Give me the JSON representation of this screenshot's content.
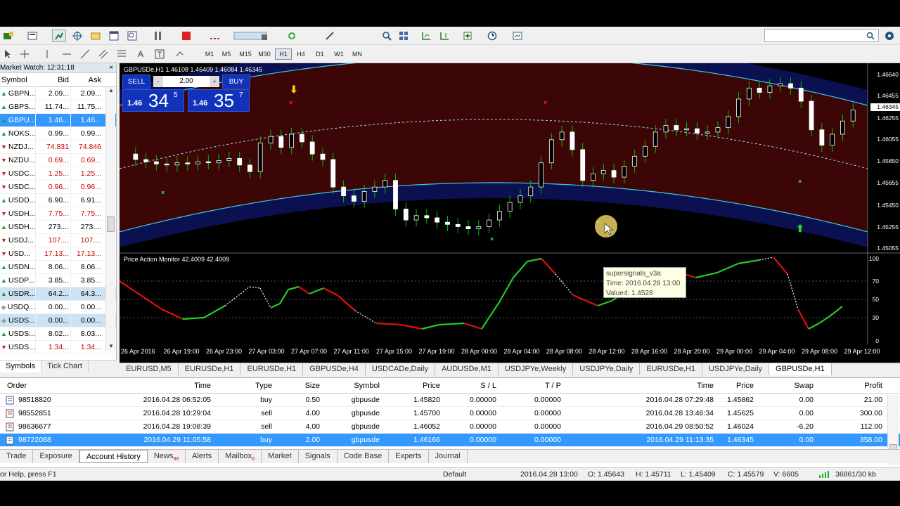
{
  "toolbar": {
    "timeframes": [
      "M1",
      "M5",
      "M15",
      "M30",
      "H1",
      "H4",
      "D1",
      "W1",
      "MN"
    ],
    "active_timeframe": "H1"
  },
  "market_watch": {
    "title": "Market Watch: 12:31:18",
    "close": "×",
    "columns": {
      "symbol": "Symbol",
      "bid": "Bid",
      "ask": "Ask"
    },
    "rows": [
      {
        "symbol": "GBPN...",
        "bid": "2.09...",
        "ask": "2.09...",
        "dir": "up",
        "state": ""
      },
      {
        "symbol": "GBPS...",
        "bid": "11.74...",
        "ask": "11.75...",
        "dir": "up",
        "state": ""
      },
      {
        "symbol": "GBPU...",
        "bid": "1.46...",
        "ask": "1.46...",
        "dir": "up",
        "state": "sel"
      },
      {
        "symbol": "NOKS...",
        "bid": "0.99...",
        "ask": "0.99...",
        "dir": "up",
        "state": ""
      },
      {
        "symbol": "NZDJ...",
        "bid": "74.831",
        "ask": "74.846",
        "dir": "up",
        "state": "",
        "red": true
      },
      {
        "symbol": "NZDU...",
        "bid": "0.69...",
        "ask": "0.69...",
        "dir": "up",
        "state": "",
        "red": true
      },
      {
        "symbol": "USDC...",
        "bid": "1.25...",
        "ask": "1.25...",
        "dir": "up",
        "state": "",
        "red": true
      },
      {
        "symbol": "USDC...",
        "bid": "0.96...",
        "ask": "0.96...",
        "dir": "up",
        "state": "",
        "red": true
      },
      {
        "symbol": "USDD...",
        "bid": "6.90...",
        "ask": "6.91...",
        "dir": "up",
        "state": ""
      },
      {
        "symbol": "USDH...",
        "bid": "7.75...",
        "ask": "7.75...",
        "dir": "up",
        "state": "",
        "red": true
      },
      {
        "symbol": "USDH...",
        "bid": "273....",
        "ask": "273....",
        "dir": "up",
        "state": ""
      },
      {
        "symbol": "USDJ...",
        "bid": "107....",
        "ask": "107....",
        "dir": "up",
        "state": "",
        "red": true
      },
      {
        "symbol": "USD...",
        "bid": "17.13...",
        "ask": "17.13...",
        "dir": "up",
        "state": "",
        "red": true
      },
      {
        "symbol": "USDN...",
        "bid": "8.06...",
        "ask": "8.06...",
        "dir": "up",
        "state": ""
      },
      {
        "symbol": "USDP...",
        "bid": "3.85...",
        "ask": "3.85...",
        "dir": "up",
        "state": ""
      },
      {
        "symbol": "USDR...",
        "bid": "64.2...",
        "ask": "64.3...",
        "dir": "up",
        "state": "hl"
      },
      {
        "symbol": "USDQ...",
        "bid": "0.00...",
        "ask": "0.00...",
        "dir": "gray",
        "state": ""
      },
      {
        "symbol": "USDS...",
        "bid": "0.00...",
        "ask": "0.00...",
        "dir": "gray",
        "state": "hl"
      },
      {
        "symbol": "USDS...",
        "bid": "8.02...",
        "ask": "8.03...",
        "dir": "up",
        "state": ""
      },
      {
        "symbol": "USDS...",
        "bid": "1.34...",
        "ask": "1.34...",
        "dir": "up",
        "state": "",
        "red": true
      }
    ],
    "tabs": [
      "Symbols",
      "Tick Chart"
    ]
  },
  "chart": {
    "title": "GBPUSDe,H1  1.46108 1.46409 1.46084 1.46345",
    "indicator_title": "Price Action Monitor 42.4009 42.4009",
    "trade_panel": {
      "sell": "SELL",
      "buy": "BUY",
      "lot": "2.00",
      "minus": "-",
      "plus": "+",
      "sell_small": "1.46",
      "sell_big": "34",
      "sell_sup": "5",
      "buy_small": "1.46",
      "buy_big": "35",
      "buy_sup": "7"
    },
    "tooltip": [
      "supersignals_v3a",
      "Time: 2016.04.28 13:00",
      "Value4: 1.4528"
    ],
    "price_ticks": [
      "1.46640",
      "1.46455",
      "1.46345",
      "1.46255",
      "1.46055",
      "1.45850",
      "1.45655",
      "1.45450",
      "1.45255",
      "1.45055"
    ],
    "current_price": "1.46345",
    "indicator_ticks": [
      "100",
      "70",
      "50",
      "30",
      "0"
    ],
    "time_ticks": [
      "26 Apr 2016",
      "26 Apr 19:00",
      "26 Apr 23:00",
      "27 Apr 03:00",
      "27 Apr 07:00",
      "27 Apr 11:00",
      "27 Apr 15:00",
      "27 Apr 19:00",
      "28 Apr 00:00",
      "28 Apr 04:00",
      "28 Apr 08:00",
      "28 Apr 12:00",
      "28 Apr 16:00",
      "28 Apr 20:00",
      "29 Apr 00:00",
      "29 Apr 04:00",
      "29 Apr 08:00",
      "29 Apr 12:00"
    ],
    "colors": {
      "bull": "#ffffff",
      "bear": "#ffffff",
      "wick": "#00c000",
      "band": "#3cc8e8",
      "outer": "#d01818",
      "osc_up": "#22cc22",
      "osc_dn": "#dd1111"
    }
  },
  "chart_tabs": [
    "EURUSD,M5",
    "EURUSDe,H1",
    "EURUSDe,H1",
    "GBPUSDe,H4",
    "USDCADe,Daily",
    "AUDUSDe,M1",
    "USDJPYe,Weekly",
    "USDJPYe,Daily",
    "EURUSDe,H1",
    "USDJPYe,Daily",
    "GBPUSDe,H1"
  ],
  "chart_tab_active": 10,
  "terminal": {
    "columns": [
      "Order",
      "Time",
      "Type",
      "Size",
      "Symbol",
      "Price",
      "S / L",
      "T / P",
      "Time",
      "Price",
      "Swap",
      "Profit"
    ],
    "rows": [
      {
        "order": "98518820",
        "time": "2016.04.28 06:52:05",
        "type": "buy",
        "size": "0.50",
        "symbol": "gbpusde",
        "price": "1.45820",
        "sl": "0.00000",
        "tp": "0.00000",
        "ctime": "2016.04.28 07:29:48",
        "cprice": "1.45862",
        "swap": "0.00",
        "profit": "21.00",
        "sel": false
      },
      {
        "order": "98552851",
        "time": "2016.04.28 10:29:04",
        "type": "sell",
        "size": "4.00",
        "symbol": "gbpusde",
        "price": "1.45700",
        "sl": "0.00000",
        "tp": "0.00000",
        "ctime": "2016.04.28 13:46:34",
        "cprice": "1.45625",
        "swap": "0.00",
        "profit": "300.00",
        "sel": false
      },
      {
        "order": "98636677",
        "time": "2016.04.28 19:08:39",
        "type": "sell",
        "size": "4.00",
        "symbol": "gbpusde",
        "price": "1.46052",
        "sl": "0.00000",
        "tp": "0.00000",
        "ctime": "2016.04.29 08:50:52",
        "cprice": "1.46024",
        "swap": "-6.20",
        "profit": "112.00",
        "sel": false
      },
      {
        "order": "98722088",
        "time": "2016.04.29 11:05:58",
        "type": "buy",
        "size": "2.00",
        "symbol": "gbpusde",
        "price": "1.46166",
        "sl": "0.00000",
        "tp": "0.00000",
        "ctime": "2016.04.29 11:13:35",
        "cprice": "1.46345",
        "swap": "0.00",
        "profit": "358.00",
        "sel": true
      }
    ],
    "tabs": [
      {
        "label": "Trade",
        "badge": ""
      },
      {
        "label": "Exposure",
        "badge": ""
      },
      {
        "label": "Account History",
        "badge": "",
        "active": true
      },
      {
        "label": "News",
        "badge": "99"
      },
      {
        "label": "Alerts",
        "badge": ""
      },
      {
        "label": "Mailbox",
        "badge": "6"
      },
      {
        "label": "Market",
        "badge": ""
      },
      {
        "label": "Signals",
        "badge": ""
      },
      {
        "label": "Code Base",
        "badge": ""
      },
      {
        "label": "Experts",
        "badge": ""
      },
      {
        "label": "Journal",
        "badge": ""
      }
    ]
  },
  "status": {
    "help": "or Help, press F1",
    "profile": "Default",
    "time": "2016.04.28 13:00",
    "open": "O: 1.45643",
    "high": "H: 1.45711",
    "low": "L: 1.45409",
    "close": "C: 1.45579",
    "volume": "V: 6605",
    "traffic": "36861/30 kb"
  }
}
